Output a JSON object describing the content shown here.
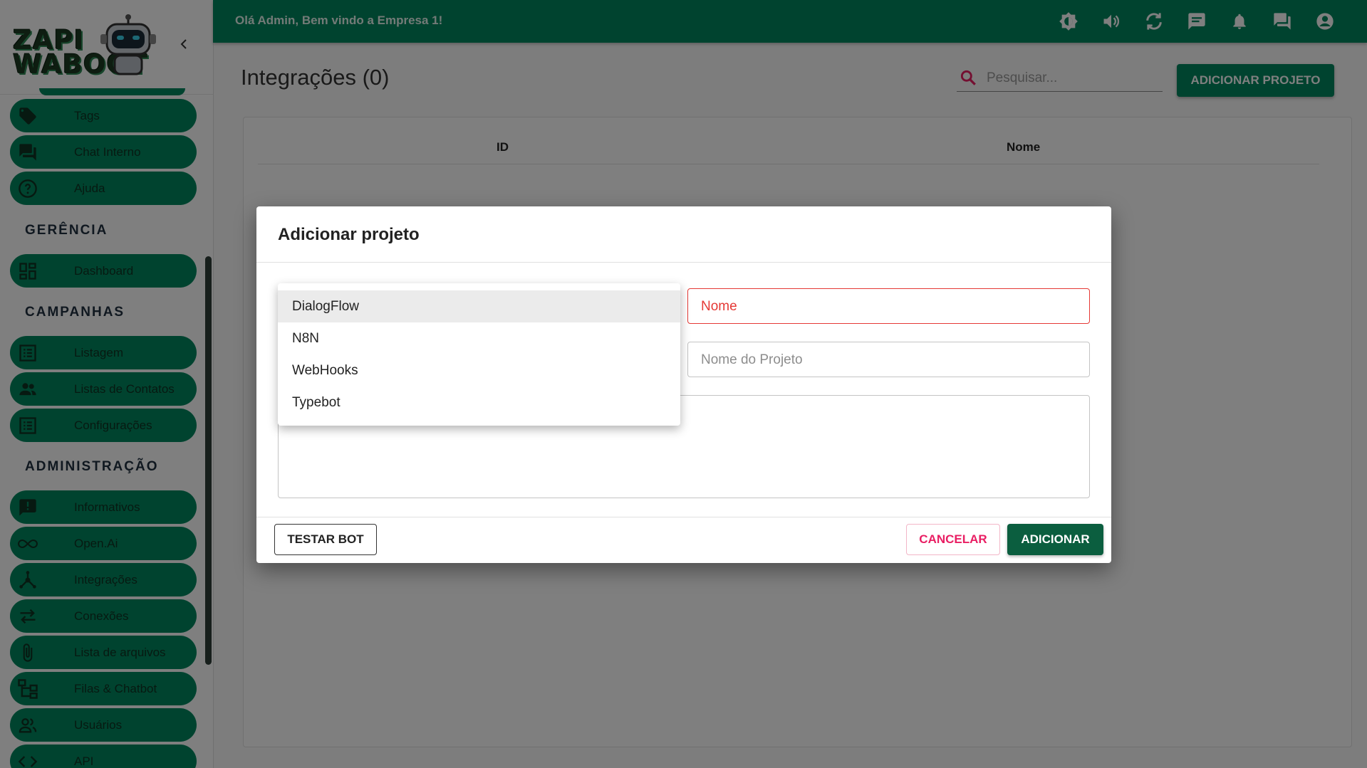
{
  "logo": {
    "line1": "ZAPI",
    "line2": "WABOOT"
  },
  "sidebar": {
    "items_top": [
      {
        "label": "Tags",
        "icon": "tag-icon"
      },
      {
        "label": "Chat Interno",
        "icon": "forum-icon"
      },
      {
        "label": "Ajuda",
        "icon": "help-icon"
      }
    ],
    "section_gerencia": "GERÊNCIA",
    "dashboard": {
      "label": "Dashboard",
      "icon": "dashboard-icon"
    },
    "section_campanhas": "CAMPANHAS",
    "campanhas": [
      {
        "label": "Listagem",
        "icon": "list-icon"
      },
      {
        "label": "Listas de Contatos",
        "icon": "people-icon"
      },
      {
        "label": "Configurações",
        "icon": "list-icon"
      }
    ],
    "section_admin": "ADMINISTRAÇÃO",
    "admin": [
      {
        "label": "Informativos",
        "icon": "announcement-icon"
      },
      {
        "label": "Open.Ai",
        "icon": "infinity-icon"
      },
      {
        "label": "Integrações",
        "icon": "hub-icon"
      },
      {
        "label": "Conexões",
        "icon": "sync-alt-icon"
      },
      {
        "label": "Lista de arquivos",
        "icon": "paperclip-icon"
      },
      {
        "label": "Filas & Chatbot",
        "icon": "flow-icon"
      },
      {
        "label": "Usuários",
        "icon": "users-icon"
      },
      {
        "label": "API",
        "icon": "code-icon"
      }
    ]
  },
  "topbar": {
    "greeting": "Olá Admin, Bem vindo a Empresa 1!",
    "icons": [
      "brightness-icon",
      "volume-icon",
      "refresh-icon",
      "chat-icon",
      "bell-icon",
      "forum-icon",
      "account-icon"
    ]
  },
  "main": {
    "title": "Integrações (0)",
    "search_placeholder": "Pesquisar...",
    "add_button": "ADICIONAR PROJETO",
    "columns": [
      "ID",
      "Nome"
    ]
  },
  "dialog": {
    "title": "Adicionar projeto",
    "type_options": [
      "DialogFlow",
      "N8N",
      "WebHooks",
      "Typebot"
    ],
    "selected_option": "DialogFlow",
    "name_placeholder": "Nome",
    "project_placeholder": "Nome do Projeto",
    "test_button": "TESTAR BOT",
    "cancel_button": "CANCELAR",
    "add_button": "ADICIONAR"
  },
  "colors": {
    "primary": "#00875f",
    "dark_button": "#0b5e3f",
    "error": "#e53935",
    "cancel": "#e91e63"
  }
}
